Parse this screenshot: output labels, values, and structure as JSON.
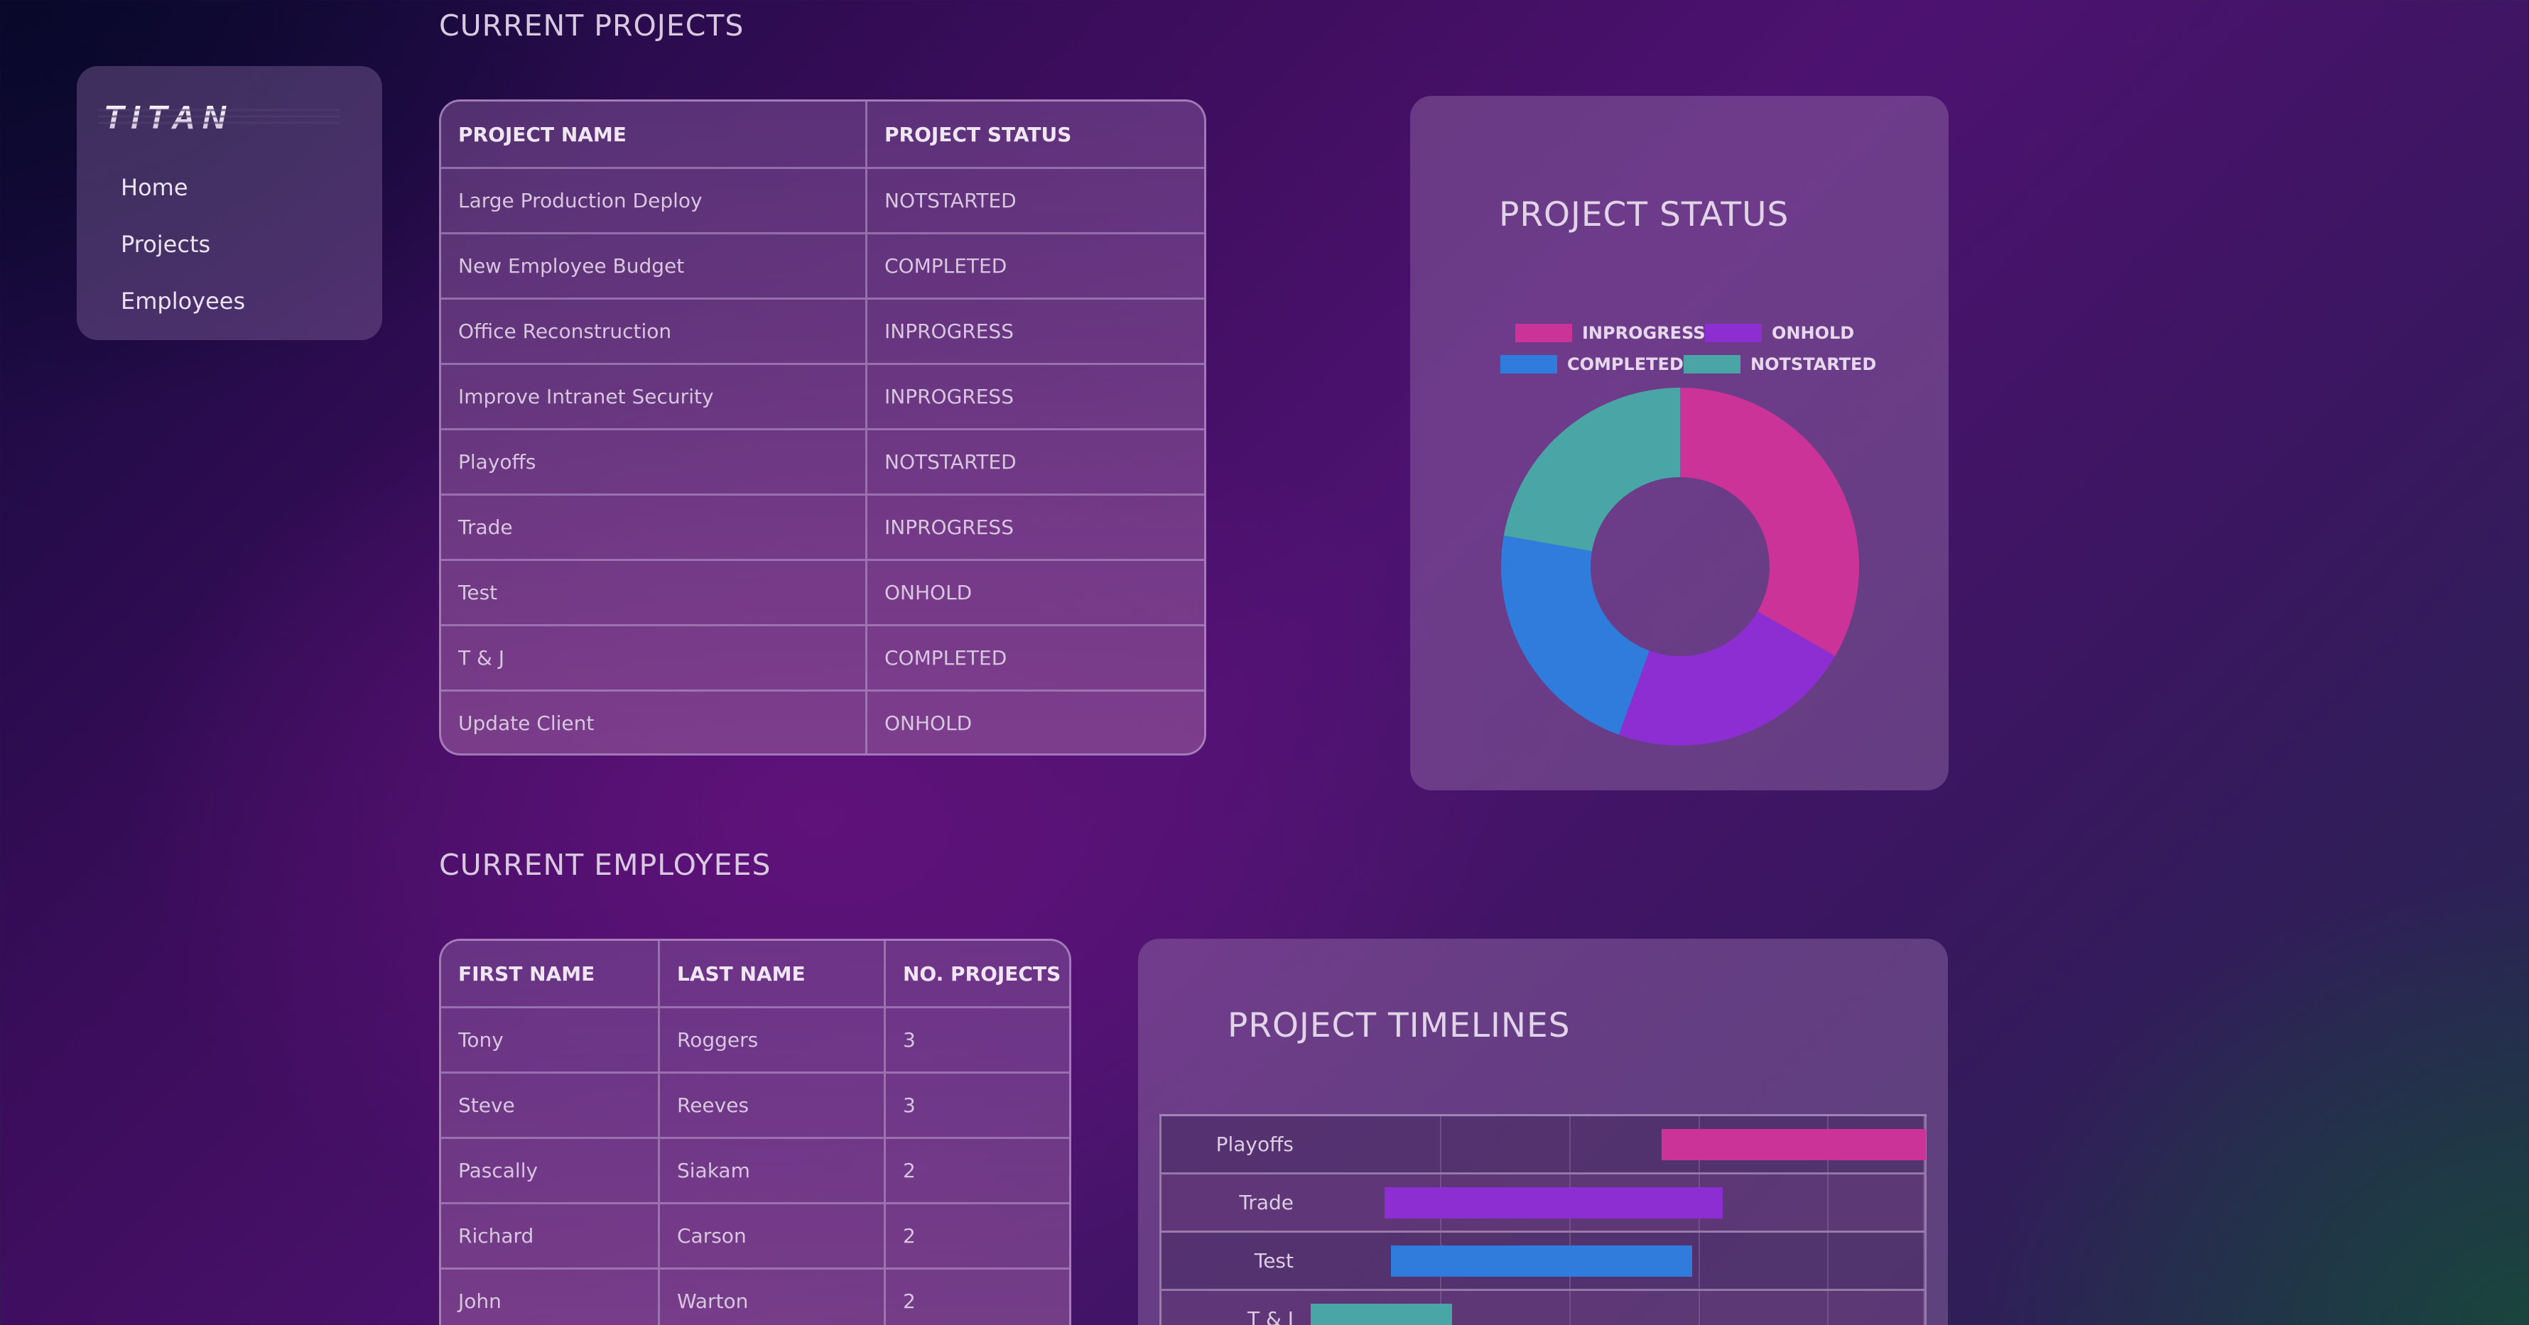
{
  "app": {
    "logo_text": "TITAN"
  },
  "nav": {
    "items": [
      {
        "label": "Home"
      },
      {
        "label": "Projects"
      },
      {
        "label": "Employees"
      }
    ]
  },
  "projects_section": {
    "title": "CURRENT PROJECTS",
    "columns": [
      "PROJECT NAME",
      "PROJECT STATUS"
    ],
    "rows": [
      [
        "Large Production Deploy",
        "NOTSTARTED"
      ],
      [
        "New Employee Budget",
        "COMPLETED"
      ],
      [
        "Office Reconstruction",
        "INPROGRESS"
      ],
      [
        "Improve Intranet Security",
        "INPROGRESS"
      ],
      [
        "Playoffs",
        "NOTSTARTED"
      ],
      [
        "Trade",
        "INPROGRESS"
      ],
      [
        "Test",
        "ONHOLD"
      ],
      [
        "T & J",
        "COMPLETED"
      ],
      [
        "Update Client",
        "ONHOLD"
      ]
    ]
  },
  "employees_section": {
    "title": "CURRENT EMPLOYEES",
    "columns": [
      "FIRST NAME",
      "LAST NAME",
      "NO. PROJECTS"
    ],
    "rows": [
      [
        "Tony",
        "Roggers",
        "3"
      ],
      [
        "Steve",
        "Reeves",
        "3"
      ],
      [
        "Pascally",
        "Siakam",
        "2"
      ],
      [
        "Richard",
        "Carson",
        "2"
      ],
      [
        "John",
        "Warton",
        "2"
      ]
    ]
  },
  "colors": {
    "inprogress": "#cc3399",
    "onhold": "#8c2ed1",
    "completed": "#2f7cdc",
    "notstarted": "#4aa6a6"
  },
  "chart_data": [
    {
      "type": "pie",
      "title": "PROJECT STATUS",
      "legend_position": "top",
      "categories": [
        "INPROGRESS",
        "ONHOLD",
        "COMPLETED",
        "NOTSTARTED"
      ],
      "values": [
        3,
        2,
        2,
        2
      ]
    },
    {
      "type": "bar",
      "title": "PROJECT TIMELINES",
      "orientation": "horizontal",
      "categories": [
        "Playoffs",
        "Trade",
        "Test",
        "T & J"
      ],
      "ranges": [
        [
          0.57,
          1.0
        ],
        [
          0.12,
          0.67
        ],
        [
          0.13,
          0.62
        ],
        [
          0.0,
          0.23
        ]
      ]
    }
  ]
}
